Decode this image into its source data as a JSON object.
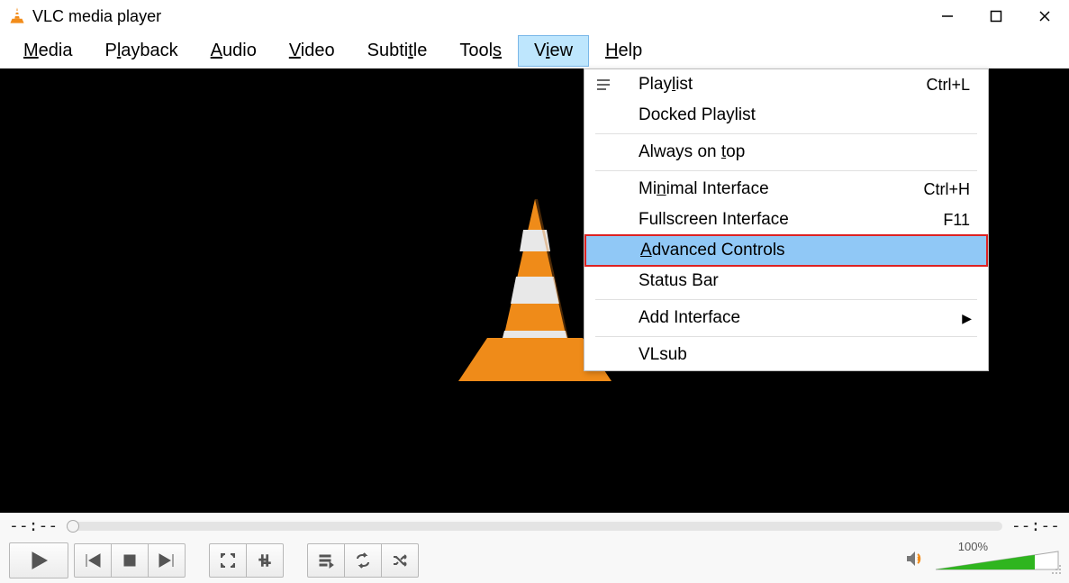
{
  "titlebar": {
    "title": "VLC media player"
  },
  "menubar": {
    "items": [
      {
        "pre": "",
        "u": "M",
        "post": "edia"
      },
      {
        "pre": "P",
        "u": "l",
        "post": "ayback"
      },
      {
        "pre": "",
        "u": "A",
        "post": "udio"
      },
      {
        "pre": "",
        "u": "V",
        "post": "ideo"
      },
      {
        "pre": "Subti",
        "u": "t",
        "post": "le"
      },
      {
        "pre": "Tool",
        "u": "s",
        "post": ""
      },
      {
        "pre": "V",
        "u": "i",
        "post": "ew"
      },
      {
        "pre": "",
        "u": "H",
        "post": "elp"
      }
    ],
    "active_index": 6
  },
  "view_menu": {
    "items": [
      {
        "type": "item",
        "pre": "Play",
        "u": "l",
        "post": "ist",
        "shortcut": "Ctrl+L",
        "icon": "playlist"
      },
      {
        "type": "item",
        "pre": "Docked Playlist",
        "u": "",
        "post": "",
        "shortcut": ""
      },
      {
        "type": "sep"
      },
      {
        "type": "item",
        "pre": "Always on ",
        "u": "t",
        "post": "op",
        "shortcut": ""
      },
      {
        "type": "sep"
      },
      {
        "type": "item",
        "pre": "Mi",
        "u": "n",
        "post": "imal Interface",
        "shortcut": "Ctrl+H"
      },
      {
        "type": "item",
        "pre": "Fullscreen Interface",
        "u": "",
        "post": "",
        "shortcut": "F11"
      },
      {
        "type": "item",
        "pre": "",
        "u": "A",
        "post": "dvanced Controls",
        "shortcut": "",
        "highlight": true
      },
      {
        "type": "item",
        "pre": "Status Bar",
        "u": "",
        "post": "",
        "shortcut": ""
      },
      {
        "type": "sep"
      },
      {
        "type": "item",
        "pre": "Add Interface",
        "u": "",
        "post": "",
        "shortcut": "",
        "submenu": true
      },
      {
        "type": "sep"
      },
      {
        "type": "item",
        "pre": "VLsub",
        "u": "",
        "post": "",
        "shortcut": ""
      }
    ]
  },
  "seek": {
    "elapsed": "--:--",
    "total": "--:--"
  },
  "volume": {
    "label": "100%",
    "level_pct": 80
  }
}
